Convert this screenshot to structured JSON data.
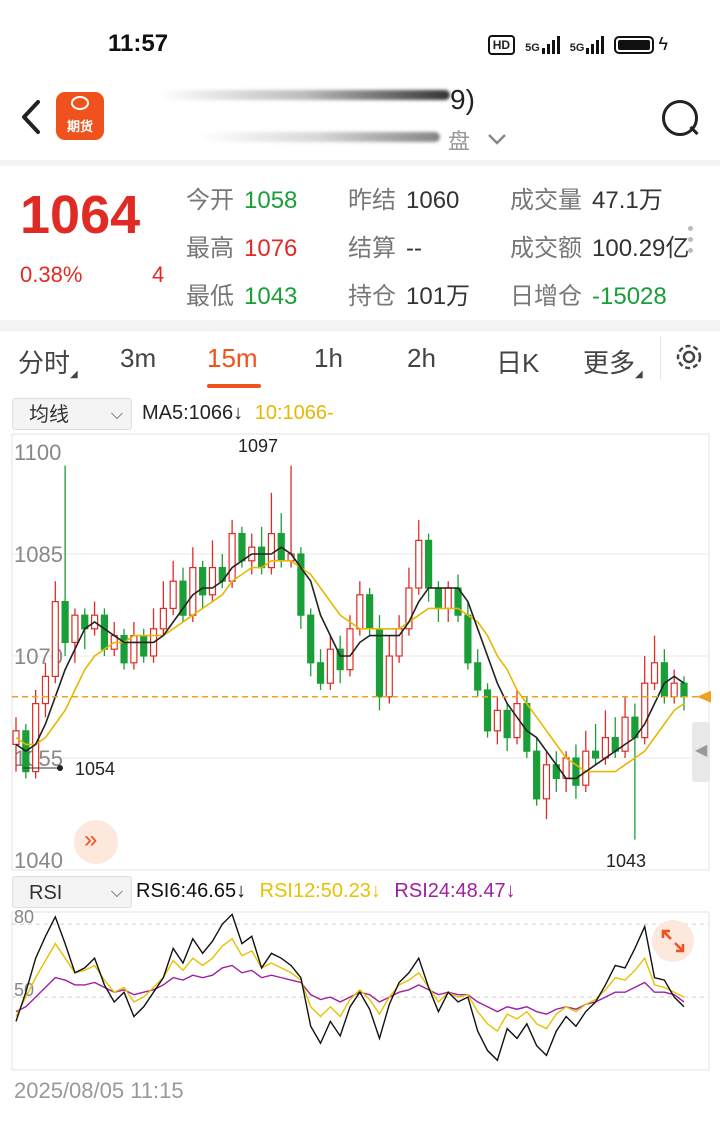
{
  "status_bar": {
    "time": "11:57",
    "hd": "HD",
    "net1": "5G",
    "net2": "5G"
  },
  "header": {
    "logo_text": "期货",
    "title_fragment": "9)",
    "subtitle_fragment": "盘"
  },
  "quote": {
    "price": "1064",
    "change_pct": "0.38%",
    "change": "4",
    "stats": [
      {
        "label": "今开",
        "value": "1058",
        "color": "green"
      },
      {
        "label": "昨结",
        "value": "1060",
        "color": "dark"
      },
      {
        "label": "成交量",
        "value": "47.1万",
        "color": "dark"
      },
      {
        "label": "最高",
        "value": "1076",
        "color": "red"
      },
      {
        "label": "结算",
        "value": "--",
        "color": "dark"
      },
      {
        "label": "成交额",
        "value": "100.29亿",
        "color": "dark"
      },
      {
        "label": "最低",
        "value": "1043",
        "color": "green"
      },
      {
        "label": "持仓",
        "value": "101万",
        "color": "dark"
      },
      {
        "label": "日增仓",
        "value": "-15028",
        "color": "green"
      }
    ]
  },
  "tabs": [
    {
      "label": "分时",
      "corner": true
    },
    {
      "label": "3m"
    },
    {
      "label": "15m",
      "active": true
    },
    {
      "label": "1h"
    },
    {
      "label": "2h"
    },
    {
      "label": "日K"
    },
    {
      "label": "更多",
      "corner": true
    }
  ],
  "main_indicator": {
    "selector": "均线",
    "ma5": "MA5:1066",
    "ma5_arrow": "↓",
    "ma10": "10:1066-"
  },
  "rsi_indicator": {
    "selector": "RSI",
    "rsi6": "RSI6:46.65",
    "rsi6_arrow": "↓",
    "rsi12": "RSI12:50.23",
    "rsi12_arrow": "↓",
    "rsi24": "RSI24:48.47",
    "rsi24_arrow": "↓"
  },
  "date_label": "2025/08/05 11:15",
  "colors": {
    "up": "#e02b24",
    "down": "#1a9e38",
    "accent": "#f0521e",
    "ma5": "#222222",
    "ma10": "#e6b800",
    "rsi6": "#111111",
    "rsi12": "#e6c200",
    "rsi24": "#a020a0"
  },
  "chart_data": [
    {
      "type": "candlestick",
      "y_ticks": [
        "1100",
        "1085",
        "1070",
        "1055",
        "1040"
      ],
      "ylim": [
        1040,
        1100
      ],
      "high_label": "1097",
      "low_label": "1043",
      "left_label": "1054",
      "last_price": 1064,
      "candles": [
        [
          1057,
          1059,
          1061,
          1053
        ],
        [
          1059,
          1053,
          1060,
          1052
        ],
        [
          1053,
          1063,
          1065,
          1052
        ],
        [
          1063,
          1067,
          1069,
          1061
        ],
        [
          1067,
          1078,
          1081,
          1066
        ],
        [
          1078,
          1072,
          1098,
          1070
        ],
        [
          1072,
          1076,
          1077,
          1069
        ],
        [
          1076,
          1074,
          1077,
          1071
        ],
        [
          1074,
          1076,
          1078,
          1073
        ],
        [
          1076,
          1071,
          1077,
          1070
        ],
        [
          1071,
          1073,
          1075,
          1070
        ],
        [
          1073,
          1069,
          1074,
          1068
        ],
        [
          1069,
          1073,
          1075,
          1068
        ],
        [
          1073,
          1070,
          1074,
          1069
        ],
        [
          1070,
          1074,
          1077,
          1069
        ],
        [
          1074,
          1077,
          1081,
          1073
        ],
        [
          1077,
          1081,
          1084,
          1076
        ],
        [
          1081,
          1076,
          1083,
          1075
        ],
        [
          1076,
          1083,
          1086,
          1075
        ],
        [
          1083,
          1079,
          1084,
          1077
        ],
        [
          1079,
          1083,
          1087,
          1078
        ],
        [
          1083,
          1081,
          1085,
          1080
        ],
        [
          1081,
          1088,
          1090,
          1080
        ],
        [
          1088,
          1084,
          1089,
          1083
        ],
        [
          1084,
          1086,
          1088,
          1082
        ],
        [
          1086,
          1083,
          1089,
          1082
        ],
        [
          1083,
          1088,
          1094,
          1082
        ],
        [
          1088,
          1084,
          1091,
          1083
        ],
        [
          1084,
          1085,
          1098,
          1083
        ],
        [
          1085,
          1076,
          1086,
          1074
        ],
        [
          1076,
          1069,
          1077,
          1067
        ],
        [
          1069,
          1066,
          1071,
          1065
        ],
        [
          1066,
          1071,
          1073,
          1065
        ],
        [
          1071,
          1068,
          1073,
          1066
        ],
        [
          1068,
          1074,
          1076,
          1067
        ],
        [
          1074,
          1079,
          1081,
          1073
        ],
        [
          1079,
          1074,
          1080,
          1073
        ],
        [
          1074,
          1064,
          1076,
          1062
        ],
        [
          1064,
          1070,
          1073,
          1063
        ],
        [
          1070,
          1074,
          1076,
          1069
        ],
        [
          1074,
          1080,
          1083,
          1073
        ],
        [
          1080,
          1087,
          1090,
          1079
        ],
        [
          1087,
          1080,
          1088,
          1078
        ],
        [
          1080,
          1077,
          1081,
          1075
        ],
        [
          1077,
          1080,
          1081,
          1075
        ],
        [
          1080,
          1076,
          1082,
          1075
        ],
        [
          1076,
          1069,
          1078,
          1068
        ],
        [
          1069,
          1065,
          1071,
          1064
        ],
        [
          1065,
          1059,
          1066,
          1058
        ],
        [
          1059,
          1062,
          1064,
          1057
        ],
        [
          1062,
          1058,
          1063,
          1056
        ],
        [
          1058,
          1063,
          1065,
          1057
        ],
        [
          1063,
          1056,
          1064,
          1055
        ],
        [
          1056,
          1049,
          1058,
          1048
        ],
        [
          1049,
          1054,
          1056,
          1046
        ],
        [
          1054,
          1052,
          1056,
          1050
        ],
        [
          1052,
          1055,
          1056,
          1050
        ],
        [
          1055,
          1051,
          1057,
          1049
        ],
        [
          1051,
          1056,
          1059,
          1050
        ],
        [
          1056,
          1055,
          1060,
          1054
        ],
        [
          1055,
          1058,
          1062,
          1054
        ],
        [
          1058,
          1056,
          1061,
          1055
        ],
        [
          1056,
          1061,
          1064,
          1055
        ],
        [
          1061,
          1058,
          1063,
          1043
        ],
        [
          1058,
          1066,
          1070,
          1057
        ],
        [
          1066,
          1069,
          1073,
          1065
        ],
        [
          1069,
          1064,
          1071,
          1063
        ],
        [
          1064,
          1066,
          1068,
          1063
        ],
        [
          1066,
          1064,
          1067,
          1062
        ]
      ],
      "ma5": [
        1057,
        1056,
        1057,
        1060,
        1064,
        1068,
        1071,
        1074,
        1075,
        1074,
        1073,
        1072,
        1072,
        1072,
        1072,
        1073,
        1075,
        1077,
        1079,
        1080,
        1080,
        1081,
        1083,
        1084,
        1085,
        1085,
        1085,
        1086,
        1085,
        1083,
        1081,
        1076,
        1073,
        1070,
        1070,
        1072,
        1073,
        1073,
        1073,
        1073,
        1075,
        1078,
        1080,
        1080,
        1080,
        1080,
        1078,
        1074,
        1070,
        1066,
        1063,
        1061,
        1059,
        1058,
        1056,
        1054,
        1052,
        1052,
        1053,
        1054,
        1055,
        1056,
        1057,
        1058,
        1060,
        1063,
        1066,
        1067,
        1066
      ],
      "ma10": [
        1058,
        1057,
        1057,
        1058,
        1060,
        1062,
        1065,
        1068,
        1070,
        1071,
        1072,
        1072,
        1073,
        1073,
        1073,
        1073,
        1074,
        1075,
        1076,
        1077,
        1078,
        1079,
        1081,
        1082,
        1083,
        1083,
        1084,
        1084,
        1084,
        1083,
        1082,
        1080,
        1078,
        1076,
        1075,
        1074,
        1074,
        1074,
        1074,
        1074,
        1075,
        1076,
        1077,
        1077,
        1077,
        1077,
        1076,
        1075,
        1073,
        1070,
        1068,
        1065,
        1063,
        1061,
        1059,
        1057,
        1055,
        1054,
        1053,
        1053,
        1053,
        1053,
        1054,
        1055,
        1056,
        1058,
        1060,
        1062,
        1063
      ]
    },
    {
      "type": "line",
      "y_ticks": [
        "80",
        "50"
      ],
      "ylim": [
        20,
        85
      ],
      "series": [
        {
          "name": "RSI6",
          "values": [
            40,
            52,
            66,
            75,
            83,
            72,
            60,
            62,
            66,
            55,
            48,
            52,
            42,
            46,
            52,
            58,
            70,
            64,
            74,
            68,
            73,
            80,
            84,
            72,
            75,
            62,
            68,
            66,
            63,
            58,
            38,
            31,
            40,
            34,
            46,
            52,
            45,
            33,
            47,
            56,
            60,
            66,
            54,
            44,
            52,
            48,
            50,
            36,
            28,
            24,
            37,
            33,
            39,
            30,
            26,
            36,
            42,
            38,
            44,
            48,
            55,
            63,
            62,
            70,
            79,
            58,
            57,
            50,
            46
          ]
        },
        {
          "name": "RSI12",
          "values": [
            42,
            50,
            58,
            65,
            72,
            66,
            60,
            61,
            63,
            57,
            52,
            54,
            48,
            50,
            54,
            58,
            65,
            61,
            66,
            63,
            66,
            71,
            74,
            67,
            69,
            62,
            64,
            62,
            60,
            57,
            46,
            42,
            46,
            42,
            49,
            53,
            49,
            43,
            50,
            55,
            57,
            60,
            54,
            48,
            52,
            50,
            51,
            44,
            39,
            36,
            43,
            41,
            44,
            39,
            37,
            43,
            46,
            44,
            47,
            49,
            53,
            58,
            57,
            61,
            66,
            55,
            54,
            52,
            50
          ]
        },
        {
          "name": "RSI24",
          "values": [
            44,
            46,
            50,
            54,
            58,
            57,
            55,
            55,
            56,
            54,
            52,
            53,
            51,
            52,
            53,
            55,
            58,
            57,
            59,
            58,
            59,
            62,
            63,
            60,
            61,
            58,
            59,
            58,
            57,
            56,
            51,
            49,
            50,
            48,
            50,
            52,
            51,
            48,
            50,
            52,
            53,
            55,
            53,
            51,
            52,
            51,
            51,
            48,
            46,
            44,
            46,
            45,
            46,
            44,
            43,
            45,
            46,
            45,
            47,
            48,
            50,
            52,
            52,
            54,
            56,
            52,
            52,
            51,
            48
          ]
        }
      ]
    }
  ]
}
